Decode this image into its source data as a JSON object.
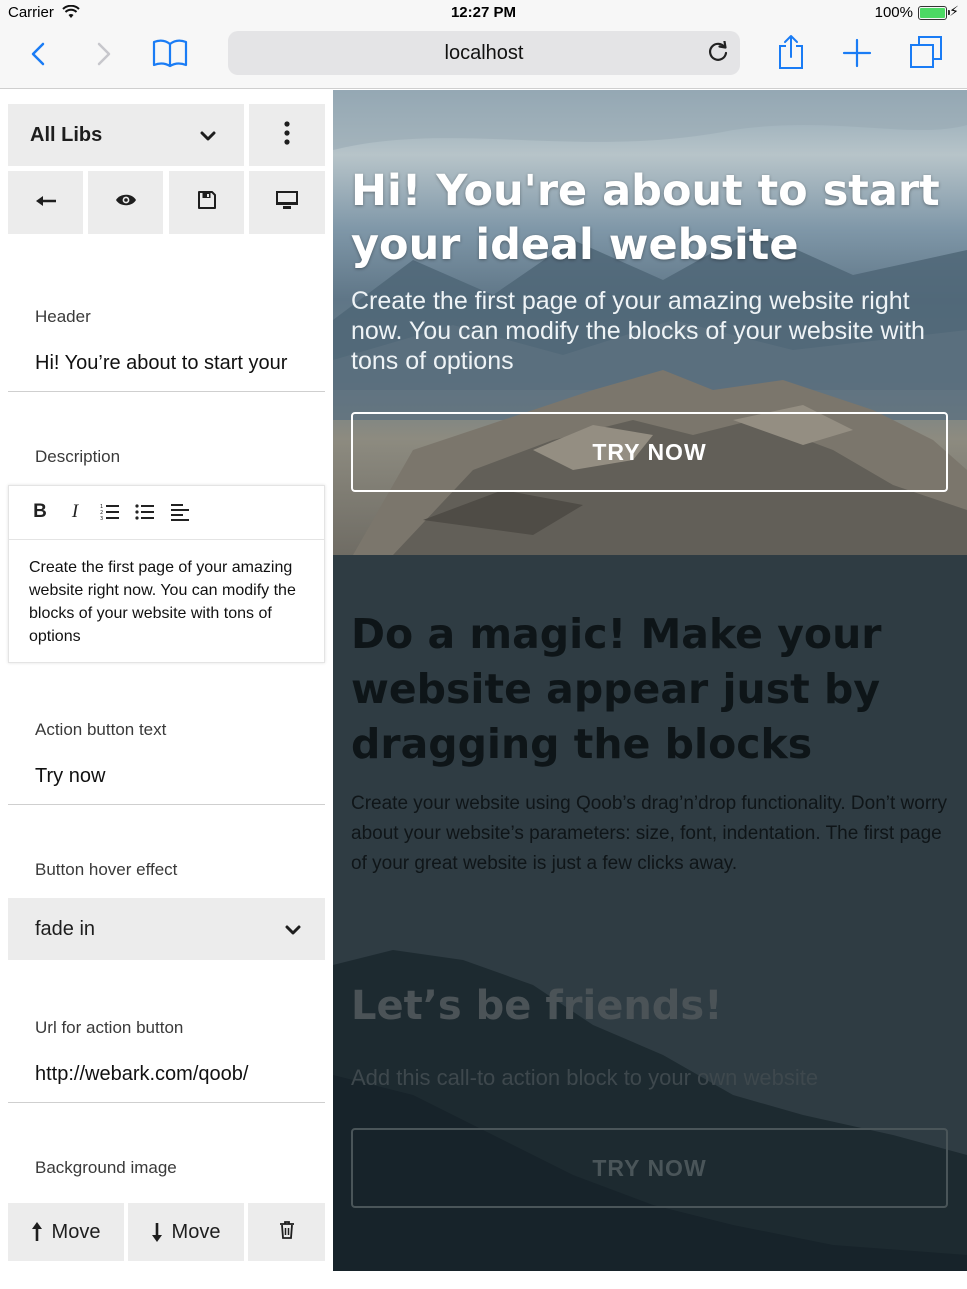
{
  "status_bar": {
    "carrier": "Carrier",
    "time": "12:27 PM",
    "battery": "100%"
  },
  "browser": {
    "url": "localhost"
  },
  "panel": {
    "library_select": "All Libs",
    "fields": {
      "header": {
        "label": "Header",
        "value": "Hi! You’re about to start your"
      },
      "description": {
        "label": "Description",
        "value": "Create the first page of your amazing website right now. You can modify the blocks of your website with tons of options"
      },
      "action_text": {
        "label": "Action button text",
        "value": "Try now"
      },
      "hover_effect": {
        "label": "Button hover effect",
        "value": "fade in"
      },
      "action_url": {
        "label": "Url for action button",
        "value": "http://webark.com/qoob/"
      },
      "background": {
        "label": "Background image"
      }
    },
    "editor_tools": {
      "bold": "B",
      "italic": "I"
    },
    "bottom": {
      "move_up": "Move",
      "move_down": "Move"
    }
  },
  "preview": {
    "hero": {
      "title": "Hi! You're about to start your ideal website",
      "description": "Create the first page of your amazing website right now. You can modify the blocks of your website with tons of options",
      "button": "TRY NOW"
    },
    "magic": {
      "title": "Do a magic! Make your website appear just by dragging the blocks",
      "description": "Create your website using Qoob’s drag’n’drop functionality. Don’t worry about your website’s parameters: size, font, indentation. The first page of your great website is just a few clicks away."
    },
    "friends": {
      "title": "Let’s be friends!",
      "description": "Add this call-to action block to your own website",
      "button": "TRY NOW"
    }
  },
  "colors": {
    "ios_blue": "#1a7cf5",
    "panel_button_bg": "#ececec",
    "battery_green": "#4cd964",
    "dark_section": "#2f3c43"
  },
  "icons": [
    "wifi-icon",
    "back-chevron-icon",
    "forward-chevron-icon",
    "bookmarks-icon",
    "reload-icon",
    "share-icon",
    "new-tab-icon",
    "tabs-icon",
    "chevron-down-icon",
    "more-vertical-icon",
    "arrow-left-icon",
    "eye-icon",
    "save-icon",
    "monitor-icon",
    "bold-icon",
    "italic-icon",
    "ordered-list-icon",
    "unordered-list-icon",
    "align-left-icon",
    "arrow-up-icon",
    "arrow-down-icon",
    "trash-icon"
  ]
}
